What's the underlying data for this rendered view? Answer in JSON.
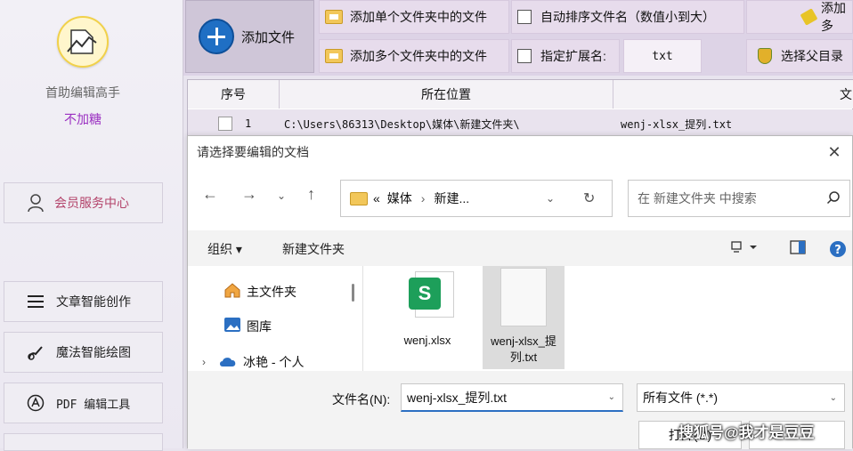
{
  "sidebar": {
    "app_name": "首助编辑高手",
    "app_sub": "不加糖",
    "member_label": "会员服务中心",
    "items": [
      {
        "label": "文章智能创作"
      },
      {
        "label": "魔法智能绘图"
      },
      {
        "label": "PDF 编辑工具"
      }
    ]
  },
  "toolbar": {
    "add_file": "添加文件",
    "add_single_folder": "添加单个文件夹中的文件",
    "add_multi_folder": "添加多个文件夹中的文件",
    "auto_sort": "自动排序文件名（数值小到大）",
    "specify_ext": "指定扩展名:",
    "ext_value": "txt",
    "add_more_truncated": "添加多",
    "select_parent": "选择父目录"
  },
  "table": {
    "headers": [
      "序号",
      "所在位置",
      "文"
    ],
    "rows": [
      {
        "index": "1",
        "location": "C:\\Users\\86313\\Desktop\\媒体\\新建文件夹\\",
        "name": "wenj-xlsx_提列.txt"
      }
    ]
  },
  "dialog": {
    "title": "请选择要编辑的文档",
    "close": "✕",
    "address": {
      "prefix": "«",
      "parts": [
        "媒体",
        "新建..."
      ]
    },
    "search_placeholder": "在 新建文件夹 中搜索",
    "organize": "组织 ▾",
    "new_folder": "新建文件夹",
    "nav_items": [
      {
        "label": "主文件夹"
      },
      {
        "label": "图库"
      },
      {
        "label": "冰艳 - 个人"
      }
    ],
    "files": [
      {
        "name": "wenj.xlsx",
        "selected": false
      },
      {
        "name": "wenj-xlsx_提列.txt",
        "selected": true
      }
    ],
    "filename_label": "文件名(N):",
    "filename_value": "wenj-xlsx_提列.txt",
    "filter_value": "所有文件 (*.*)",
    "open_button": "打开(O)"
  },
  "watermark": "搜狐号@我才是豆豆",
  "colors": {
    "accent": "#1f6fc4",
    "sub_purple": "#9a2fc1",
    "member_pink": "#b3436a"
  }
}
